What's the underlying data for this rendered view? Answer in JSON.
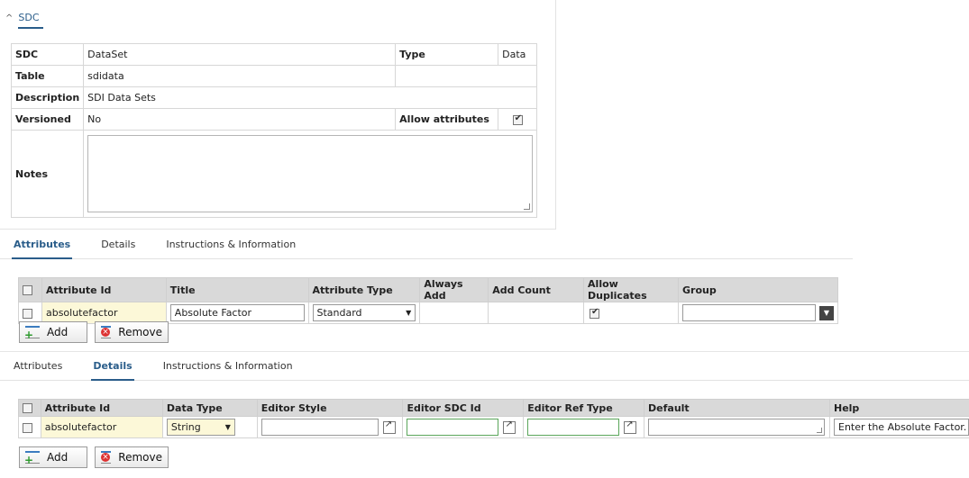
{
  "sdc_section": {
    "title": "SDC"
  },
  "properties": {
    "sdc_label": "SDC",
    "sdc_value": "DataSet",
    "type_label": "Type",
    "type_value": "Data",
    "table_label": "Table",
    "table_value": "sdidata",
    "description_label": "Description",
    "description_value": "SDI Data Sets",
    "versioned_label": "Versioned",
    "versioned_value": "No",
    "allow_attributes_label": "Allow attributes",
    "allow_attributes_checked": true,
    "notes_label": "Notes",
    "notes_value": ""
  },
  "tabs1": [
    {
      "label": "Attributes",
      "active": true
    },
    {
      "label": "Details",
      "active": false
    },
    {
      "label": "Instructions & Information",
      "active": false
    }
  ],
  "attributes_grid": {
    "headers": [
      "Attribute Id",
      "Title",
      "Attribute Type",
      "Always Add",
      "Add Count",
      "Allow Duplicates",
      "Group"
    ],
    "row": {
      "attribute_id": "absolutefactor",
      "title": "Absolute Factor",
      "attribute_type": "Standard",
      "always_add": "",
      "add_count": "",
      "allow_duplicates": true,
      "group": ""
    }
  },
  "buttons1": {
    "add": "Add",
    "remove": "Remove"
  },
  "tabs2": [
    {
      "label": "Attributes",
      "active": false
    },
    {
      "label": "Details",
      "active": true
    },
    {
      "label": "Instructions & Information",
      "active": false
    }
  ],
  "details_grid": {
    "headers": [
      "Attribute Id",
      "Data Type",
      "Editor Style",
      "Editor SDC Id",
      "Editor Ref Type",
      "Default",
      "Help"
    ],
    "row": {
      "attribute_id": "absolutefactor",
      "data_type": "String",
      "editor_style": "",
      "editor_sdc_id": "",
      "editor_ref_type": "",
      "default": "",
      "help": "Enter the Absolute Factor."
    }
  },
  "buttons2": {
    "add": "Add",
    "remove": "Remove"
  },
  "colors": {
    "accent": "#2a5d8a",
    "header_bg": "#d9d9d9",
    "yellow": "#fcf8d8",
    "green": "#5aa55a"
  }
}
